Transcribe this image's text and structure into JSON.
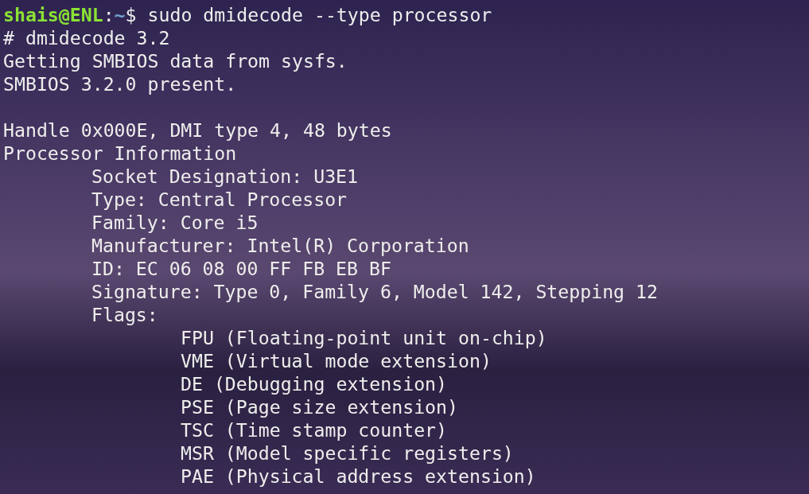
{
  "prompt": {
    "user_host": "shais@ENL",
    "separator": ":",
    "path": "~",
    "symbol": "$",
    "command": "sudo dmidecode --type processor"
  },
  "output": [
    {
      "kind": "plain",
      "text": "# dmidecode 3.2"
    },
    {
      "kind": "plain",
      "text": "Getting SMBIOS data from sysfs."
    },
    {
      "kind": "plain",
      "text": "SMBIOS 3.2.0 present."
    },
    {
      "kind": "blank"
    },
    {
      "kind": "plain",
      "text": "Handle 0x000E, DMI type 4, 48 bytes"
    },
    {
      "kind": "plain",
      "text": "Processor Information"
    },
    {
      "kind": "field",
      "text": "Socket Designation: U3E1"
    },
    {
      "kind": "field",
      "text": "Type: Central Processor"
    },
    {
      "kind": "field",
      "text": "Family: Core i5"
    },
    {
      "kind": "field",
      "text": "Manufacturer: Intel(R) Corporation"
    },
    {
      "kind": "field",
      "text": "ID: EC 06 08 00 FF FB EB BF"
    },
    {
      "kind": "field",
      "text": "Signature: Type 0, Family 6, Model 142, Stepping 12"
    },
    {
      "kind": "field",
      "text": "Flags:"
    },
    {
      "kind": "flag",
      "text": "FPU (Floating-point unit on-chip)"
    },
    {
      "kind": "flag",
      "text": "VME (Virtual mode extension)"
    },
    {
      "kind": "flag",
      "text": "DE (Debugging extension)"
    },
    {
      "kind": "flag",
      "text": "PSE (Page size extension)"
    },
    {
      "kind": "flag",
      "text": "TSC (Time stamp counter)"
    },
    {
      "kind": "flag",
      "text": "MSR (Model specific registers)"
    },
    {
      "kind": "flag",
      "text": "PAE (Physical address extension)"
    }
  ]
}
